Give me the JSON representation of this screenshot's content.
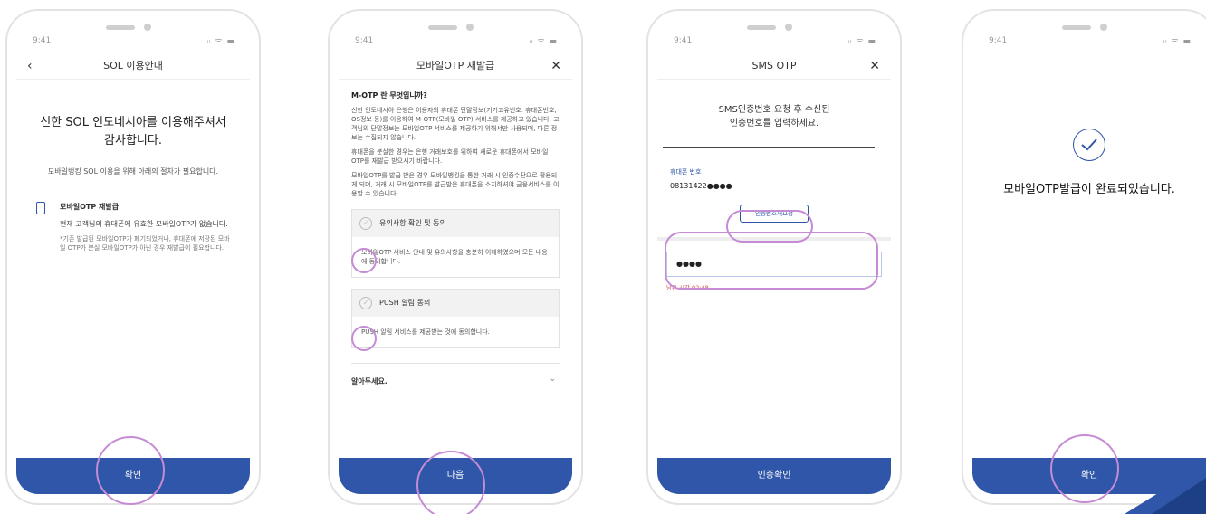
{
  "status": {
    "time": "9:41",
    "signal": "ᵢₗ ᯤ ▬"
  },
  "screen1": {
    "nav_title": "SOL 이용안내",
    "back": "‹",
    "title_line1": "신한 SOL 인도네시아를 이용해주셔서",
    "title_line2": "감사합니다.",
    "subtitle": "모바일뱅킹 SOL 이용을 위해 아래의 절차가 필요합니다.",
    "card_title": "모바일OTP 재발급",
    "card_desc": "현재 고객님의 휴대폰에 유효한 모바일OTP가 없습니다.",
    "card_note": "*기존 발급된 모바일OTP가 폐기되었거나, 휴대폰에 저장된 모바일 OTP가 분실 모바일OTP가 아닌 경우 재발급이 필요합니다.",
    "button": "확인"
  },
  "screen2": {
    "nav_title": "모바일OTP 재발급",
    "close": "✕",
    "question": "M-OTP 란 무엇입니까?",
    "para1": "신한 인도네시아 은행은 이용자의 휴대폰 단말정보(기기고유번호, 휴대폰번호, OS정보 등)를 이용하여 M-OTP(모바일 OTP) 서비스를 제공하고 있습니다. 고객님의 단말정보는 모바일OTP 서비스를 제공하기 위해서만 사용되며, 다른 정보는 수집되지 않습니다.",
    "para2": "휴대폰을 분실한 경우는 은행 거래보호를 위하여 새로운 휴대폰에서 모바일OTP를 재발급 받으시기 바랍니다.",
    "para3": "모바일OTP를 발급 받은 경우 모바일뱅킹을 통한 거래 시 인증수단으로 활용되게 되며, 거래 시 모바일OTP를 발급받은 휴대폰을 소지하셔야 금융서비스를 이용할 수 있습니다.",
    "agree1_title": "유의사항 확인 및 동의",
    "agree1_body": "모바일OTP 서비스 안내 및 유의사항을 충분히 이해하였으며 모든 내용에 동의합니다.",
    "agree2_title": "PUSH 알림 동의",
    "agree2_body": "PUSH 알림 서비스를 제공받는 것에 동의합니다.",
    "know": "알아두세요.",
    "button": "다음"
  },
  "screen3": {
    "nav_title": "SMS OTP",
    "close": "✕",
    "msg_line1": "SMS인증번호 요청 후 수신된",
    "msg_line2": "인증번호를 입력하세요.",
    "phone_label": "휴대폰 번호",
    "phone_value": "08131422●●●●",
    "resend": "인증번호재요청",
    "code_value": "●●●●",
    "timer": "남은 시간 02:48",
    "button": "인증확인"
  },
  "screen4": {
    "done": "모바일OTP발급이 완료되었습니다.",
    "button": "확인"
  },
  "colors": {
    "primary": "#2f56a8",
    "highlight": "#c58bd4",
    "warning": "#d34a4a"
  }
}
